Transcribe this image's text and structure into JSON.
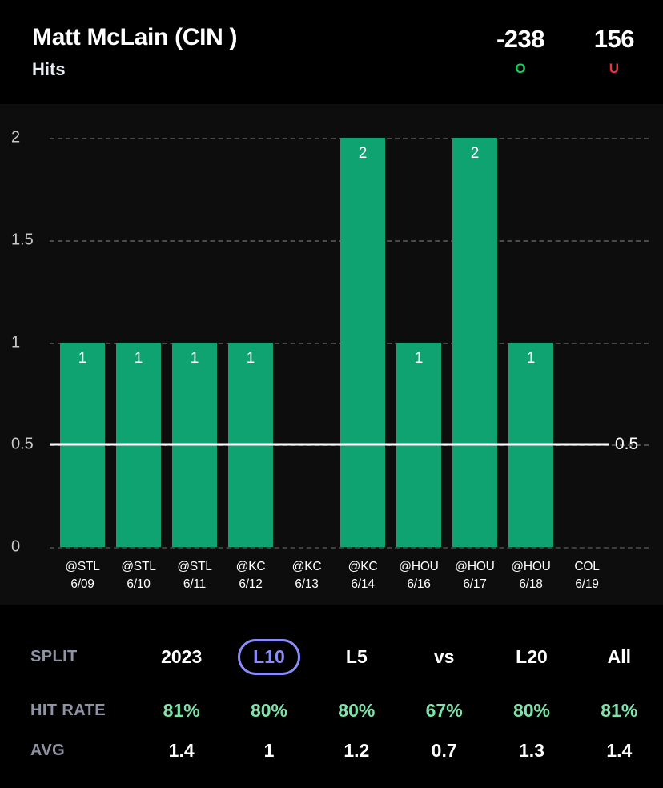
{
  "header": {
    "player_name": "Matt McLain (CIN )",
    "stat_type": "Hits",
    "over": {
      "odds": "-238",
      "label": "O"
    },
    "under": {
      "odds": "156",
      "label": "U"
    },
    "over_color": "#13d15f",
    "under_color": "#f0313f"
  },
  "chart_data": {
    "type": "bar",
    "title": "Hits",
    "xlabel": "",
    "ylabel": "",
    "ylim": [
      0,
      2
    ],
    "yticks": [
      "0",
      "0.5",
      "1",
      "1.5",
      "2"
    ],
    "ytick_values": [
      0,
      0.5,
      1,
      1.5,
      2
    ],
    "grid": true,
    "legend": "none",
    "bar_color": "#0fa371",
    "threshold": {
      "value": 0.5,
      "label": "0.5",
      "color": "#ffffff"
    },
    "categories": [
      "@STL 6/09",
      "@STL 6/10",
      "@STL 6/11",
      "@KC 6/12",
      "@KC 6/13",
      "@KC 6/14",
      "@HOU 6/16",
      "@HOU 6/17",
      "@HOU 6/18",
      "COL 6/19"
    ],
    "tick_opponents": [
      "@STL",
      "@STL",
      "@STL",
      "@KC",
      "@KC",
      "@KC",
      "@HOU",
      "@HOU",
      "@HOU",
      "COL"
    ],
    "tick_dates": [
      "6/09",
      "6/10",
      "6/11",
      "6/12",
      "6/13",
      "6/14",
      "6/16",
      "6/17",
      "6/18",
      "6/19"
    ],
    "values": [
      1,
      1,
      1,
      1,
      null,
      2,
      1,
      2,
      1,
      null
    ],
    "value_labels": [
      "1",
      "1",
      "1",
      "1",
      "",
      "2",
      "1",
      "2",
      "1",
      ""
    ]
  },
  "stats": {
    "rows": [
      {
        "head": "SPLIT",
        "type": "split",
        "values": [
          "2023",
          "L10",
          "L5",
          "vs",
          "L20",
          "All"
        ],
        "active_index": 1
      },
      {
        "head": "HIT RATE",
        "type": "hit",
        "values": [
          "81%",
          "80%",
          "80%",
          "67%",
          "80%",
          "81%"
        ]
      },
      {
        "head": "AVG",
        "type": "avg",
        "values": [
          "1.4",
          "1",
          "1.2",
          "0.7",
          "1.3",
          "1.4"
        ]
      }
    ],
    "active_color": "#8b8cf7",
    "hit_color": "#7ee3a8"
  }
}
